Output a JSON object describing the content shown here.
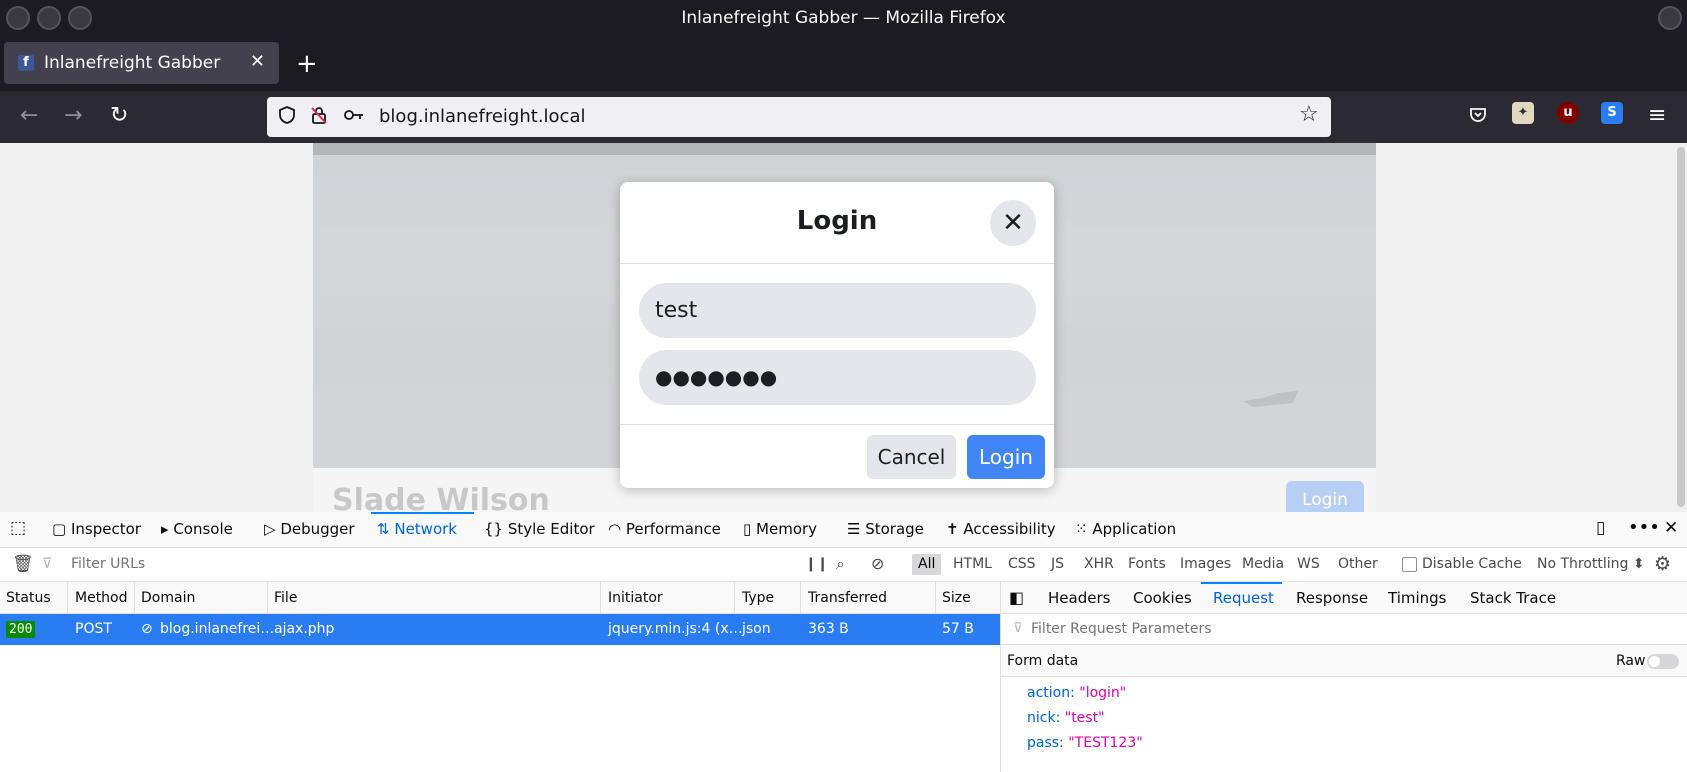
{
  "window": {
    "title": "Inlanefreight Gabber — Mozilla Firefox"
  },
  "tab": {
    "label": "Inlanefreight Gabber",
    "favicon": "f"
  },
  "urlbar": {
    "url": "blog.inlanefreight.local"
  },
  "page": {
    "profile_name": "Slade Wilson",
    "bg_login_button": "Login"
  },
  "modal": {
    "title": "Login",
    "username_value": "test",
    "password_value": "●●●●●●●",
    "cancel_label": "Cancel",
    "login_label": "Login"
  },
  "devtools": {
    "tabs": [
      "Inspector",
      "Console",
      "Debugger",
      "Network",
      "Style Editor",
      "Performance",
      "Memory",
      "Storage",
      "Accessibility",
      "Application"
    ],
    "active_tab": "Network",
    "filter_placeholder": "Filter URLs",
    "type_filters": [
      "All",
      "HTML",
      "CSS",
      "JS",
      "XHR",
      "Fonts",
      "Images",
      "Media",
      "WS",
      "Other"
    ],
    "disable_cache_label": "Disable Cache",
    "throttling_label": "No Throttling ⬍",
    "columns": [
      "Status",
      "Method",
      "Domain",
      "File",
      "Initiator",
      "Type",
      "Transferred",
      "Size"
    ],
    "request": {
      "status": "200",
      "method": "POST",
      "domain": "blog.inlanefrei…",
      "file": "ajax.php",
      "initiator": "jquery.min.js:4 (x…",
      "type": "json",
      "transferred": "363 B",
      "size": "57 B"
    },
    "side_tabs": [
      "Headers",
      "Cookies",
      "Request",
      "Response",
      "Timings",
      "Stack Trace"
    ],
    "side_active_tab": "Request",
    "param_filter_placeholder": "Filter Request Parameters",
    "form_data_label": "Form data",
    "raw_label": "Raw",
    "form_data": [
      {
        "key": "action:",
        "value": "\"login\""
      },
      {
        "key": "nick:",
        "value": "\"test\""
      },
      {
        "key": "pass:",
        "value": "\"TEST123\""
      }
    ]
  },
  "colors": {
    "accent": "#0060df",
    "selected_row": "#2a7cf3",
    "login_button": "#4285f4",
    "status_ok": "#058b00"
  }
}
